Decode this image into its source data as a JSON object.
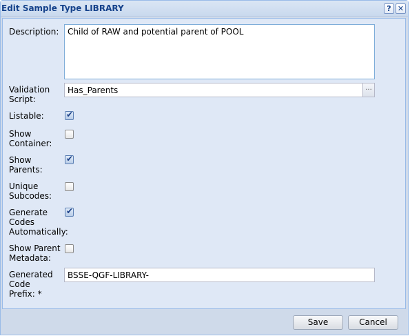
{
  "window": {
    "title": "Edit Sample Type LIBRARY",
    "help_glyph": "?",
    "close_glyph": "✕"
  },
  "form": {
    "description": {
      "label": "Description:",
      "value": "Child of RAW and potential parent of POOL"
    },
    "validation_script": {
      "label_line1": "Validation",
      "label_line2": "Script:",
      "value": "Has_Parents",
      "trigger_glyph": "..."
    },
    "listable": {
      "label": "Listable:",
      "checked": true
    },
    "show_container": {
      "label_line1": "Show",
      "label_line2": "Container:",
      "checked": false
    },
    "show_parents": {
      "label_line1": "Show",
      "label_line2": "Parents:",
      "checked": true
    },
    "unique_subcodes": {
      "label_line1": "Unique",
      "label_line2": "Subcodes:",
      "checked": false
    },
    "generate_codes": {
      "label_line1": "Generate",
      "label_line2": "Codes",
      "label_line3": "Automatically:",
      "checked": true
    },
    "show_parent_metadata": {
      "label_line1": "Show Parent",
      "label_line2": "Metadata:",
      "checked": false
    },
    "code_prefix": {
      "label_line1": "Generated",
      "label_line2": "Code",
      "label_line3": "Prefix: *",
      "value": "BSSE-QGF-LIBRARY-"
    },
    "check_glyph": "✔"
  },
  "buttons": {
    "save_label": "Save",
    "cancel_label": "Cancel"
  },
  "colors": {
    "title_text": "#15428b",
    "panel_bg": "#dfe8f6",
    "frame_bg": "#cfdaea",
    "border": "#99bbe8"
  }
}
